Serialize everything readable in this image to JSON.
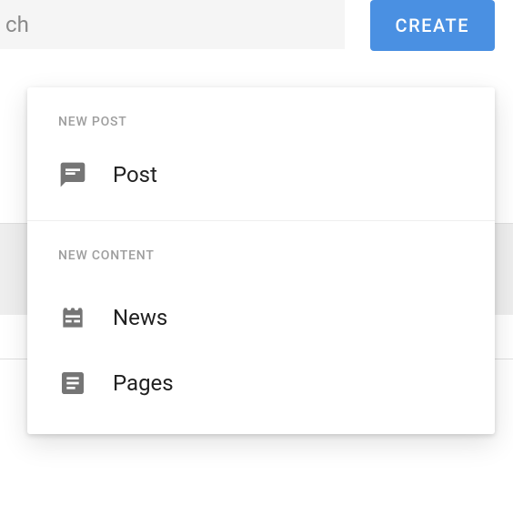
{
  "search": {
    "placeholder": "ch",
    "value": ""
  },
  "create_button": {
    "label": "CREATE"
  },
  "dropdown": {
    "section1": {
      "header": "NEW POST",
      "items": [
        {
          "label": "Post",
          "icon": "chat"
        }
      ]
    },
    "section2": {
      "header": "NEW CONTENT",
      "items": [
        {
          "label": "News",
          "icon": "news"
        },
        {
          "label": "Pages",
          "icon": "page"
        }
      ]
    }
  },
  "colors": {
    "primary": "#4a90e2",
    "icon": "#757575",
    "muted": "#9e9e9e",
    "text": "#212121"
  }
}
